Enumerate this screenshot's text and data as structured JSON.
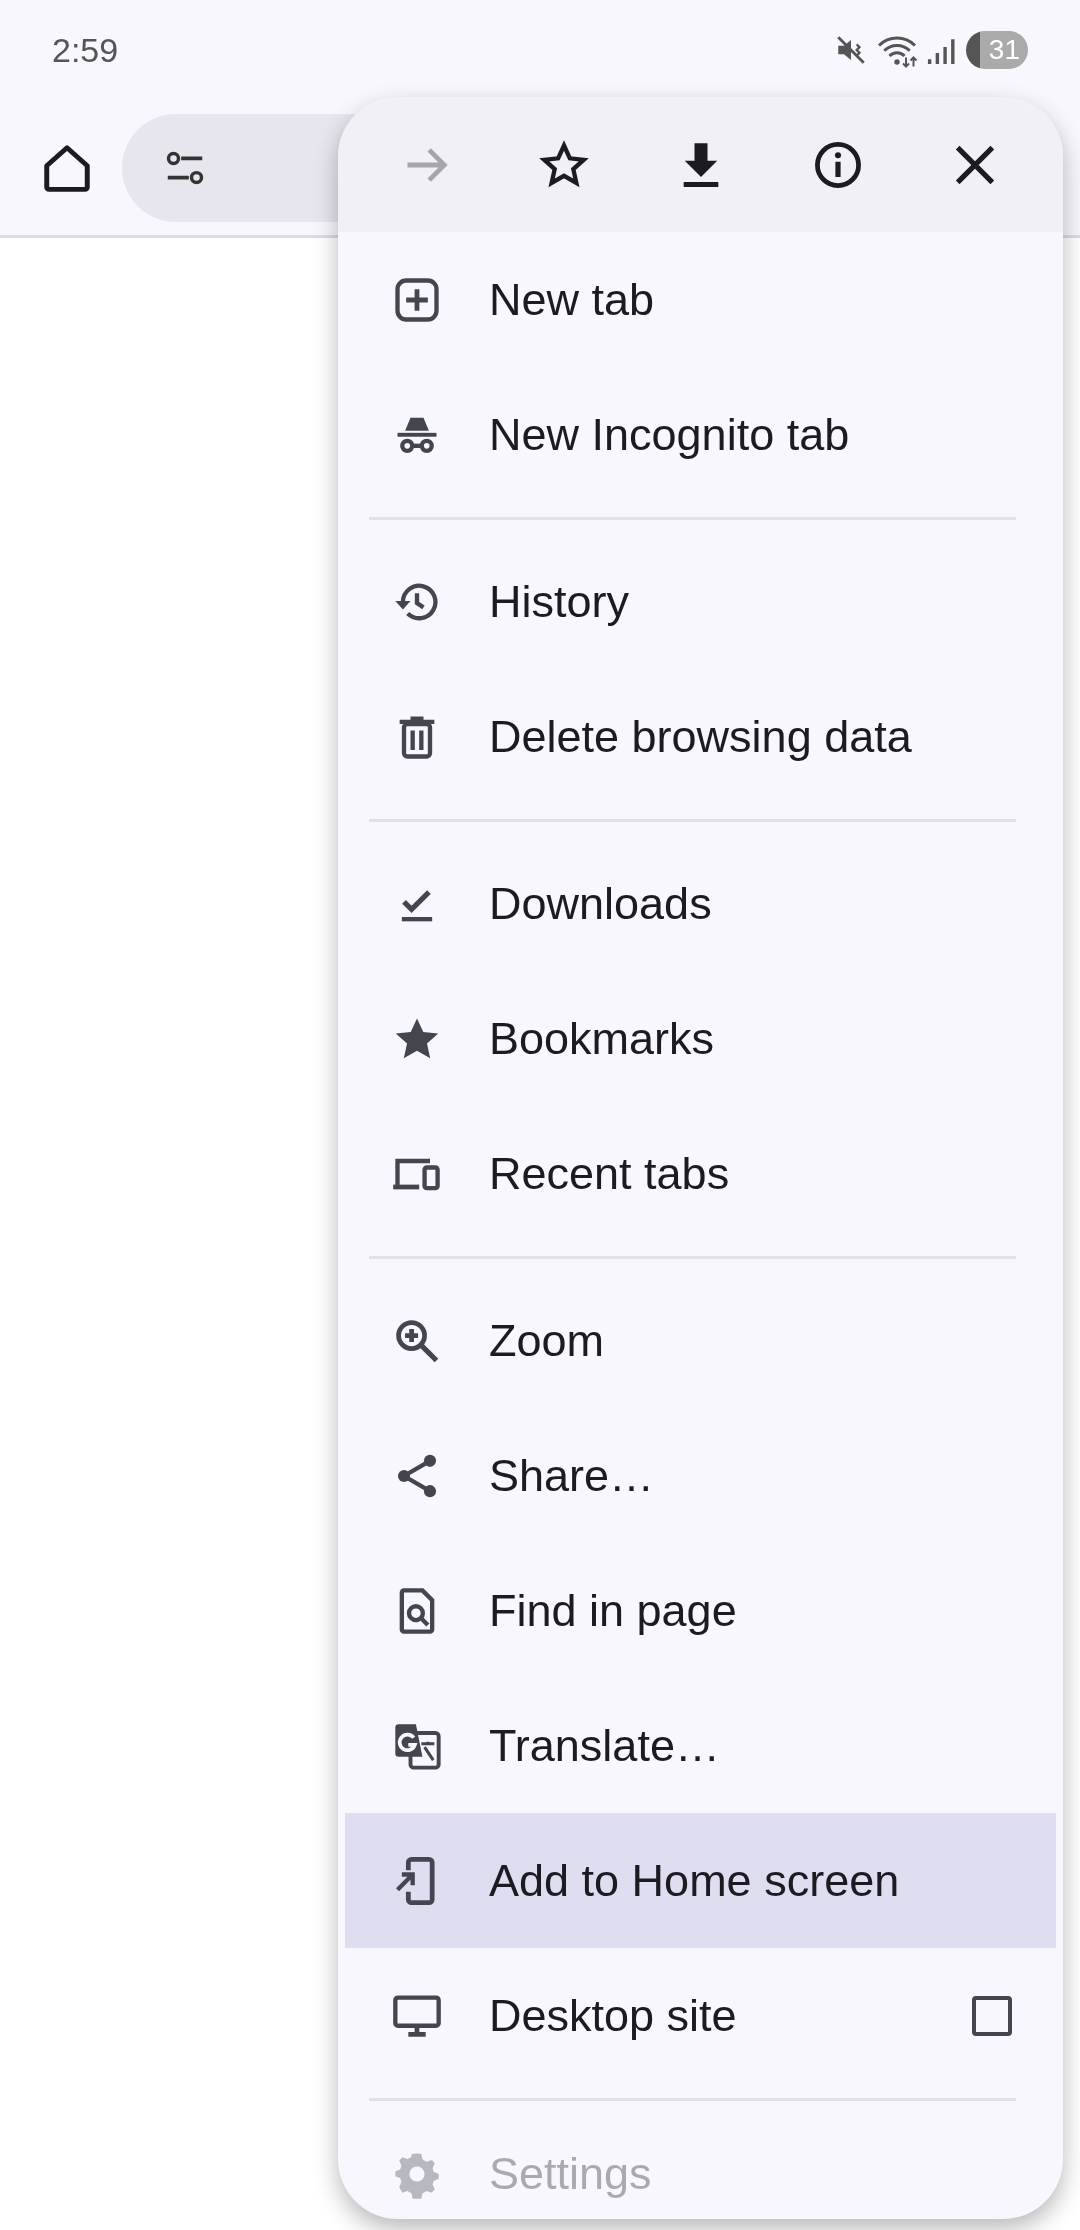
{
  "status_bar": {
    "time": "2:59",
    "battery": "31"
  },
  "menu": {
    "actions": [
      {
        "kind": "forward",
        "disabled": true
      },
      {
        "kind": "bookmark",
        "disabled": false
      },
      {
        "kind": "download",
        "disabled": false
      },
      {
        "kind": "info",
        "disabled": false
      },
      {
        "kind": "close",
        "disabled": false
      }
    ],
    "items": [
      {
        "kind": "item",
        "label": "New tab",
        "selected": false
      },
      {
        "kind": "item",
        "label": "New Incognito tab",
        "selected": false
      },
      {
        "kind": "divider"
      },
      {
        "kind": "item",
        "label": "History",
        "selected": false
      },
      {
        "kind": "item",
        "label": "Delete browsing data",
        "selected": false
      },
      {
        "kind": "divider"
      },
      {
        "kind": "item",
        "label": "Downloads",
        "selected": false
      },
      {
        "kind": "item",
        "label": "Bookmarks",
        "selected": false
      },
      {
        "kind": "item",
        "label": "Recent tabs",
        "selected": false
      },
      {
        "kind": "divider"
      },
      {
        "kind": "item",
        "label": "Zoom",
        "selected": false
      },
      {
        "kind": "item",
        "label": "Share…",
        "selected": false
      },
      {
        "kind": "item",
        "label": "Find in page",
        "selected": false
      },
      {
        "kind": "item",
        "label": "Translate…",
        "selected": false
      },
      {
        "kind": "item",
        "label": "Add to Home screen",
        "selected": true
      },
      {
        "kind": "check",
        "label": "Desktop site",
        "selected": false,
        "checked": false
      },
      {
        "kind": "divider"
      },
      {
        "kind": "item",
        "label": "Settings",
        "selected": false
      }
    ]
  }
}
